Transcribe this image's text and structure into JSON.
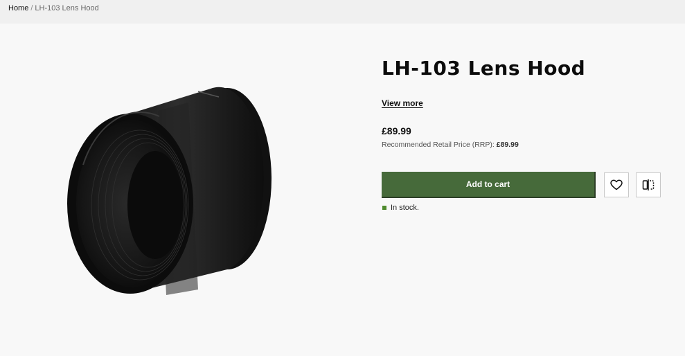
{
  "breadcrumb": {
    "home": "Home",
    "separator": "/",
    "current": "LH-103 Lens Hood"
  },
  "product": {
    "title": "LH-103 Lens Hood",
    "view_more": "View more",
    "price": "£89.99",
    "rrp_label": "Recommended Retail Price (RRP):",
    "rrp_value": "£89.99",
    "add_to_cart": "Add to cart",
    "stock_status": "In stock."
  },
  "icons": {
    "wishlist": "heart-icon",
    "compare": "compare-icon",
    "stock": "stock-indicator-icon"
  },
  "colors": {
    "accent": "#466a3a",
    "stock": "#4f8a2e"
  }
}
